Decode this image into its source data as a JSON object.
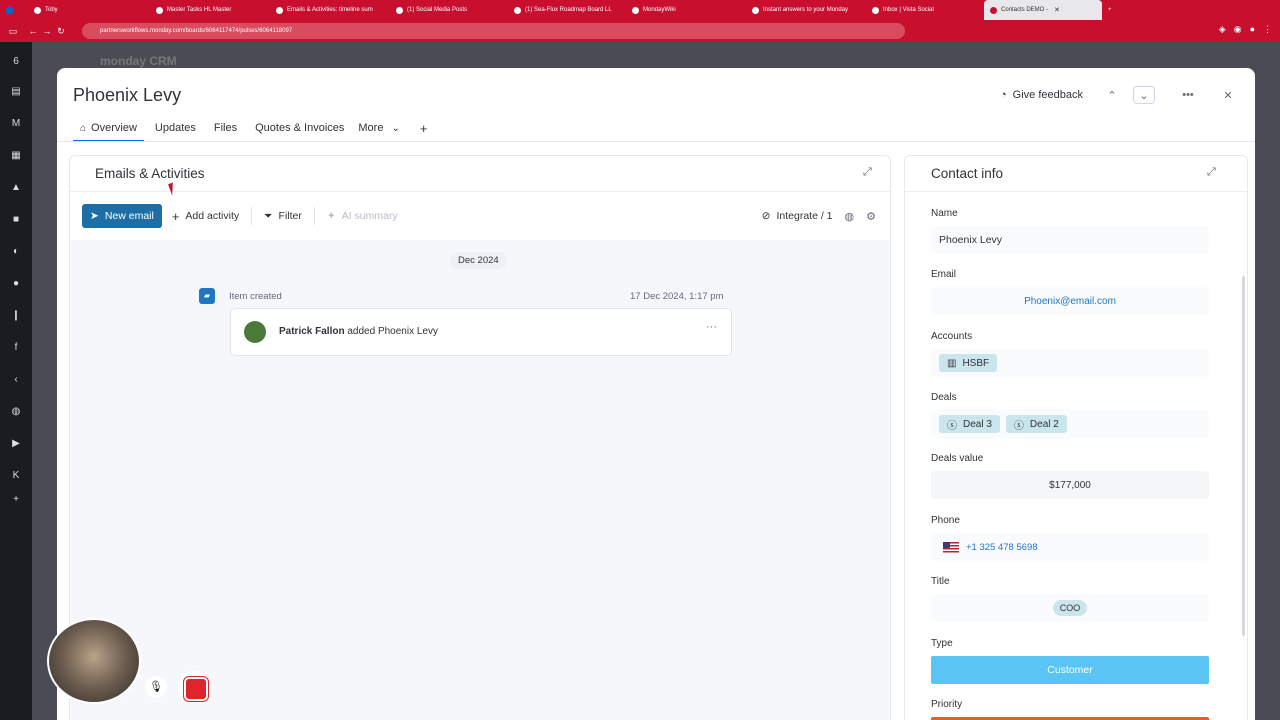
{
  "browser": {
    "tabs": [
      {
        "label": "Toby",
        "active": false
      },
      {
        "label": "Master Tasks HL Master",
        "active": false
      },
      {
        "label": "Emails & Activities: timeline sum",
        "active": false
      },
      {
        "label": "(1) Social Media Posts",
        "active": false
      },
      {
        "label": "(1) Sea-Flux Roadmap Board LL",
        "active": false
      },
      {
        "label": "MondayWiki",
        "active": false
      },
      {
        "label": "Instant answers to your Monday",
        "active": false
      },
      {
        "label": "Inbox | Vista Social",
        "active": false
      },
      {
        "label": "Contacts DEMO -",
        "active": true
      }
    ],
    "url": "partnersworkflows.monday.com/boards/6064117474/pulses/6064118097",
    "tab_add": "+"
  },
  "app": {
    "brand": "monday CRM"
  },
  "modal": {
    "title": "Phoenix Levy",
    "feedback_label": "Give feedback",
    "tabs": [
      {
        "label": "Overview"
      },
      {
        "label": "Updates"
      },
      {
        "label": "Files"
      },
      {
        "label": "Quotes & Invoices"
      },
      {
        "label": "More"
      }
    ],
    "add_tab": "+"
  },
  "activities": {
    "title": "Emails & Activities",
    "new_email": "New email",
    "add_activity": "Add activity",
    "filter": "Filter",
    "ai_summary": "AI summary",
    "integrate": "Integrate / 1",
    "date_group": "Dec 2024",
    "item_label": "Item created",
    "item_time": "17 Dec 2024, 1:17 pm",
    "card_author": "Patrick Fallon",
    "card_text": "added Phoenix Levy",
    "card_more": "···"
  },
  "contact": {
    "title": "Contact info",
    "name_label": "Name",
    "name_value": "Phoenix Levy",
    "email_label": "Email",
    "email_value": "Phoenix@email.com",
    "accounts_label": "Accounts",
    "account_chip": "HSBF",
    "deals_label": "Deals",
    "deal_chips": [
      "Deal 3",
      "Deal 2"
    ],
    "deals_value_label": "Deals value",
    "deals_value": "$177,000",
    "phone_label": "Phone",
    "phone_value": "+1 325 478 5698",
    "title_label": "Title",
    "title_value": "COO",
    "type_label": "Type",
    "type_value": "Customer",
    "priority_label": "Priority"
  },
  "colors": {
    "browser_red": "#c8102e",
    "primary": "#1b6fa6",
    "customer": "#5ac4f5",
    "priority": "#f05a2a"
  }
}
